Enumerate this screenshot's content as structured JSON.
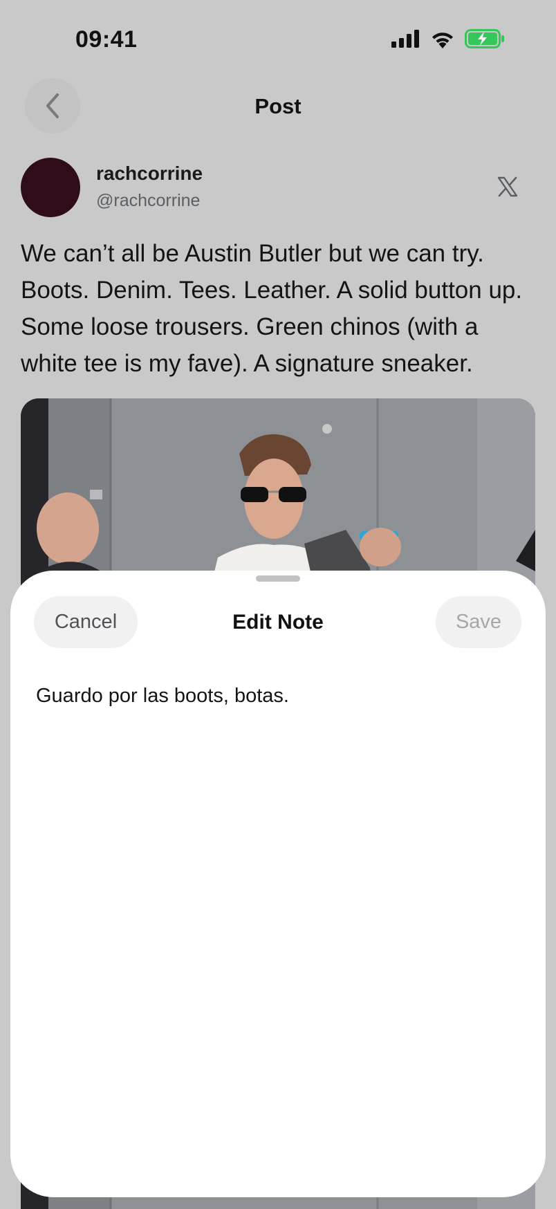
{
  "status_bar": {
    "time": "09:41"
  },
  "header": {
    "title": "Post",
    "back_icon": "chevron-left-icon"
  },
  "post": {
    "author_name": "rachcorrine",
    "author_handle": "@rachcorrine",
    "source_icon": "x-logo-icon",
    "avatar_color": "#2e0c19",
    "text": "We can’t all be Austin Butler but we can try. Boots. Denim. Tees. Leather. A solid button up. Some loose trousers. Green chinos (with a white tee is my fave). A signature sneaker."
  },
  "edit_note_sheet": {
    "cancel_label": "Cancel",
    "title": "Edit Note",
    "save_label": "Save",
    "note_text": "Guardo por las boots, botas."
  },
  "colors": {
    "battery_green": "#35c759",
    "dim_overlay": "#c9c9c9",
    "sheet_background": "#ffffff"
  }
}
